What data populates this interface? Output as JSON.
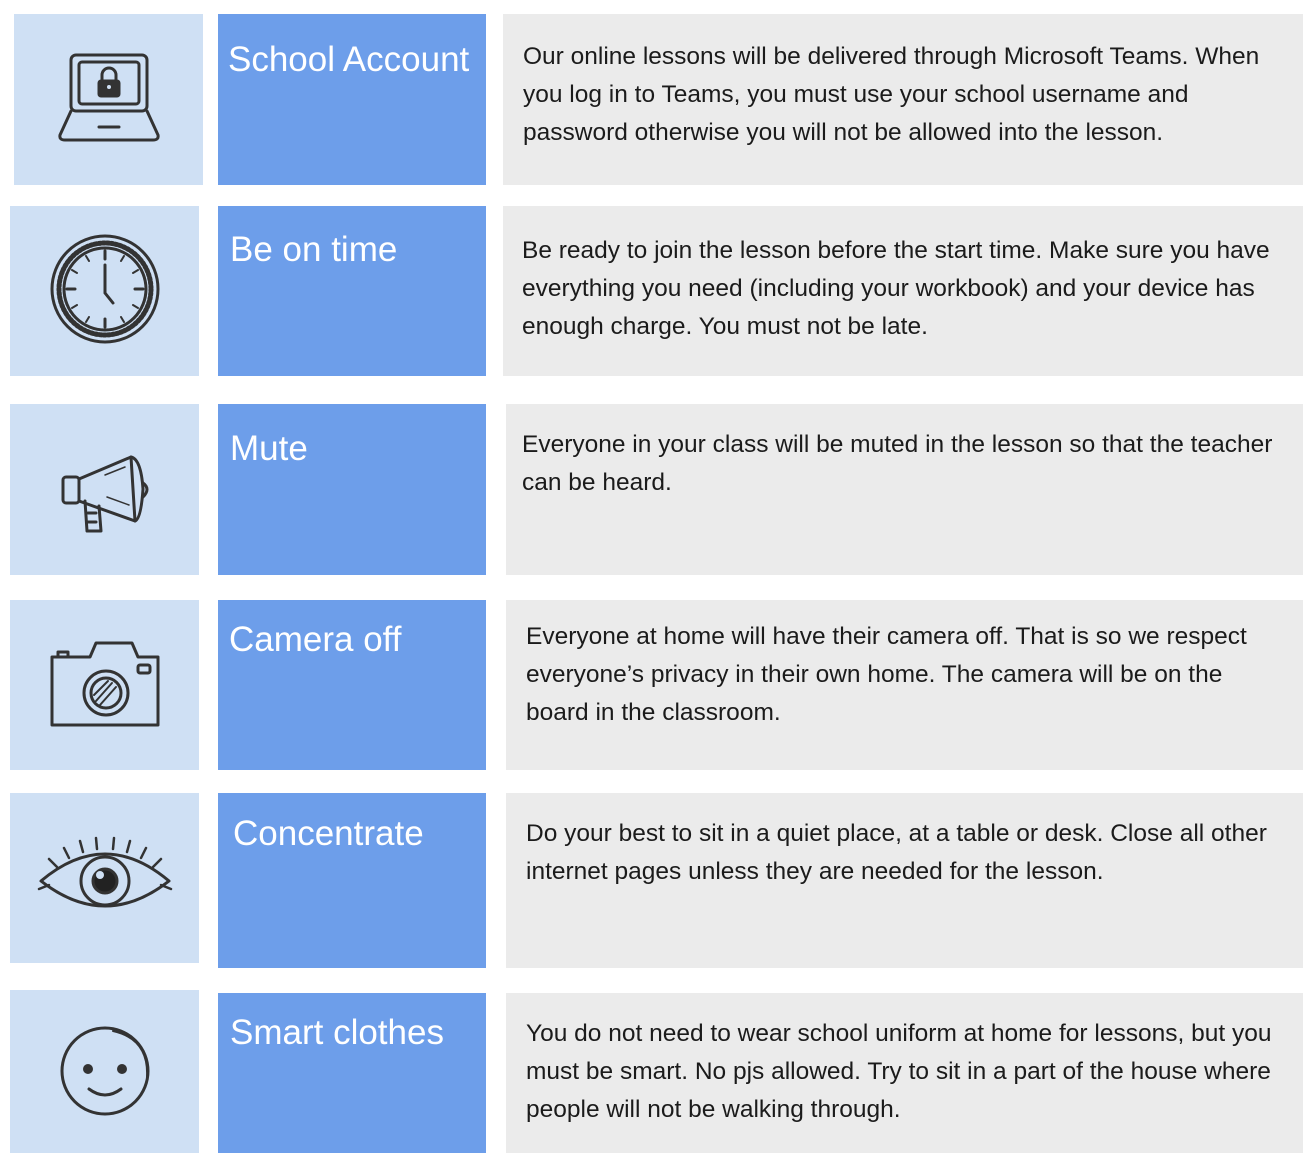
{
  "rules": [
    {
      "icon": "laptop-lock-icon",
      "title": "School Account",
      "text": "Our online lessons will be delivered through Microsoft Teams. When you log in to Teams, you must use your school username and password otherwise you will not be allowed into the lesson."
    },
    {
      "icon": "clock-icon",
      "title": "Be on time",
      "text": "Be ready to join the lesson before the start time. Make sure you have everything you need (including your workbook) and your device has enough charge. You must not be late."
    },
    {
      "icon": "megaphone-icon",
      "title": "Mute",
      "text": "Everyone in your class will be muted in the lesson so that the teacher can be heard."
    },
    {
      "icon": "camera-icon",
      "title": "Camera off",
      "text": "Everyone at home will have their camera off. That is so we respect everyone’s privacy in their own home. The camera will be on the board in the classroom."
    },
    {
      "icon": "eye-icon",
      "title": "Concentrate",
      "text": "Do your best to sit in a quiet place, at a table or desk. Close all other internet pages unless they are needed for the lesson."
    },
    {
      "icon": "smiley-face-icon",
      "title": "Smart clothes",
      "text": "You do not need to wear school uniform at home for lessons, but you must be smart. No pjs allowed. Try to sit in a part of the house where people will not be walking through."
    }
  ]
}
